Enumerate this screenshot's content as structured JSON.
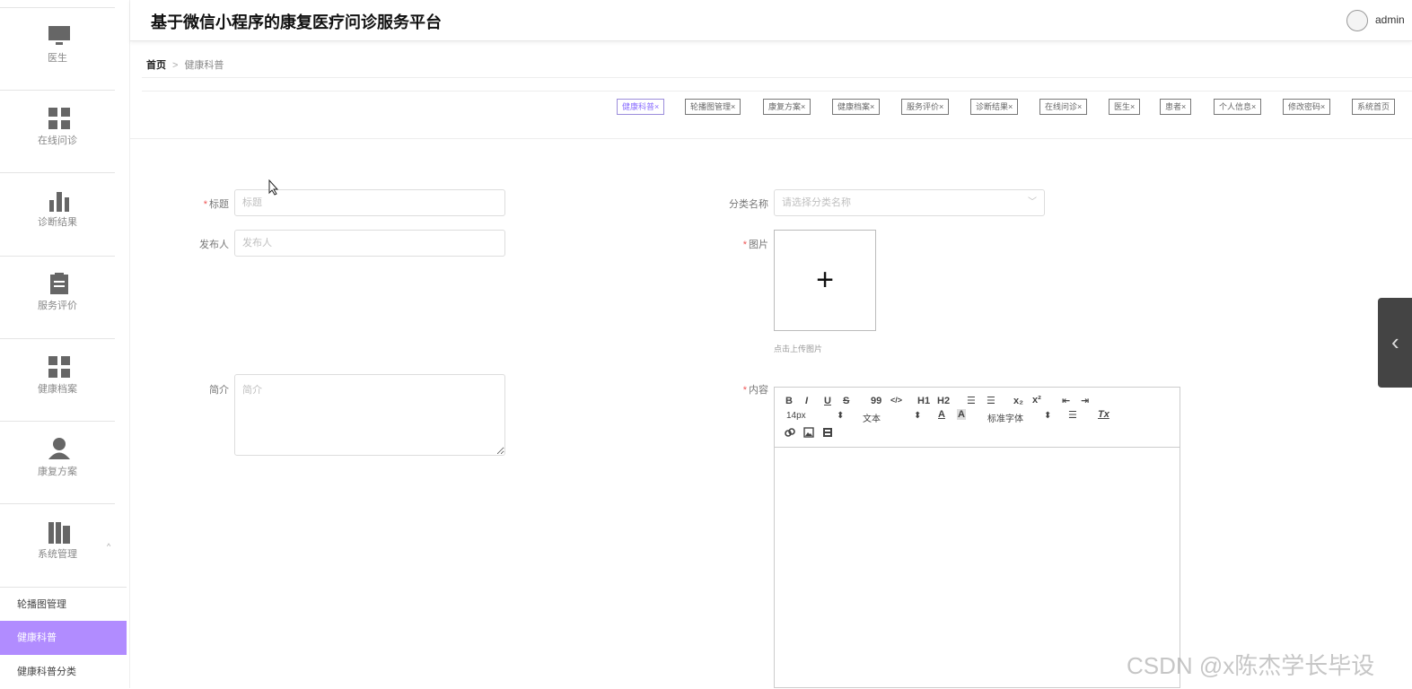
{
  "header": {
    "title": "基于微信小程序的康复医疗问诊服务平台",
    "user": "admin"
  },
  "sidebar": {
    "items": [
      {
        "label": "医生",
        "icon": "monitor-icon"
      },
      {
        "label": "在线问诊",
        "icon": "grid-icon"
      },
      {
        "label": "诊断结果",
        "icon": "bar-chart-icon"
      },
      {
        "label": "服务评价",
        "icon": "clipboard-icon"
      },
      {
        "label": "健康档案",
        "icon": "grid-icon"
      },
      {
        "label": "康复方案",
        "icon": "person-icon"
      },
      {
        "label": "系统管理",
        "icon": "books-icon"
      }
    ],
    "submenu": [
      "轮播图管理",
      "健康科普",
      "健康科普分类"
    ],
    "expand_glyph": "^"
  },
  "breadcrumb": {
    "home": "首页",
    "sep": ">",
    "current": "健康科普"
  },
  "tags": [
    {
      "label": "健康科普",
      "active": true
    },
    {
      "label": "轮播图管理"
    },
    {
      "label": "康复方案"
    },
    {
      "label": "健康档案"
    },
    {
      "label": "服务评价"
    },
    {
      "label": "诊断结果"
    },
    {
      "label": "在线问诊"
    },
    {
      "label": "医生"
    },
    {
      "label": "患者"
    },
    {
      "label": "个人信息"
    },
    {
      "label": "修改密码"
    },
    {
      "label": "系统首页"
    }
  ],
  "tag_close": "×",
  "form": {
    "title_label": "标题",
    "title_placeholder": "标题",
    "publisher_label": "发布人",
    "publisher_placeholder": "发布人",
    "intro_label": "简介",
    "intro_placeholder": "简介",
    "category_label": "分类名称",
    "category_placeholder": "请选择分类名称",
    "image_label": "图片",
    "image_hint": "点击上传图片",
    "upload_glyph": "+",
    "content_label": "内容",
    "required_mark": "*"
  },
  "editor": {
    "bold": "B",
    "italic": "I",
    "underline": "U",
    "strike": "S",
    "quote": "99",
    "code": "</>",
    "h1": "H1",
    "h2": "H2",
    "ordered_list": "☰",
    "bullet_list": "☰",
    "sub": "x₂",
    "sup": "x²",
    "outdent": "⇤",
    "indent": "⇥",
    "font_size": "14px",
    "text_type": "文本",
    "font_family": "标准字体",
    "align": "☰",
    "clear": "Tx",
    "select_arrow": "⬍"
  },
  "watermark": "CSDN @x陈杰学长毕设",
  "collapse_glyph": "‹"
}
